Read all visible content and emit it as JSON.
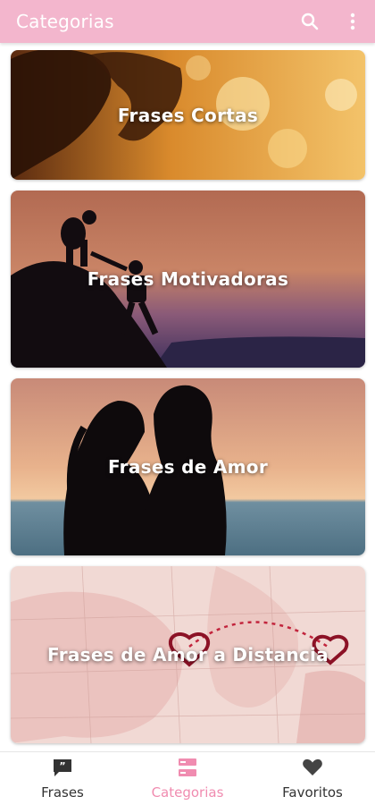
{
  "appbar": {
    "title": "Categorias",
    "icons": [
      "search-icon",
      "more-vert-icon"
    ]
  },
  "categories": [
    {
      "label": "Frases Cortas"
    },
    {
      "label": "Frases Motivadoras"
    },
    {
      "label": "Frases de Amor"
    },
    {
      "label": "Frases de Amor a Distancia"
    }
  ],
  "bottom_nav": {
    "items": [
      {
        "label": "Frases",
        "icon": "quote-icon",
        "active": false
      },
      {
        "label": "Categorias",
        "icon": "categories-icon",
        "active": true
      },
      {
        "label": "Favoritos",
        "icon": "heart-icon",
        "active": false
      }
    ]
  },
  "colors": {
    "appbar": "#f3b6cd",
    "active": "#f08cb0",
    "inactive": "#333333"
  }
}
